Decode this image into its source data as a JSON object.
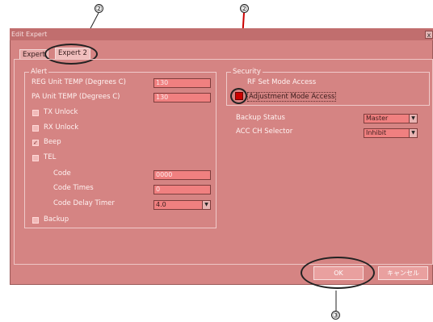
{
  "window": {
    "title": "Edit Expert",
    "close": "x"
  },
  "tabs": [
    {
      "label": "Expert"
    },
    {
      "label": "Expert 2"
    }
  ],
  "alert": {
    "legend": "Alert",
    "reg_label": "REG Unit TEMP (Degrees C)",
    "reg_value": "130",
    "pa_label": "PA Unit TEMP (Degrees C)",
    "pa_value": "130",
    "tx_unlock": "TX Unlock",
    "rx_unlock": "RX Unlock",
    "beep": "Beep",
    "beep_checked": "true",
    "tel": "TEL",
    "code_label": "Code",
    "code_value": "0000",
    "code_times_label": "Code Times",
    "code_times_value": "0",
    "code_delay_label": "Code Delay Timer",
    "code_delay_value": "4.0",
    "backup": "Backup"
  },
  "security": {
    "legend": "Security",
    "rf_set": "RF Set Mode Access",
    "adjustment": "Adjustment Mode Access"
  },
  "backup_status": {
    "label": "Backup Status",
    "value": "Master"
  },
  "acc_ch": {
    "label": "ACC CH Selector",
    "value": "Inhibit"
  },
  "buttons": {
    "ok": "OK",
    "cancel": "キャンセル"
  },
  "markers": {
    "m1": "②",
    "m2": "②",
    "m3": "③"
  },
  "colors": {
    "overlay": "#d58483",
    "highlight_red": "#cc0000"
  }
}
